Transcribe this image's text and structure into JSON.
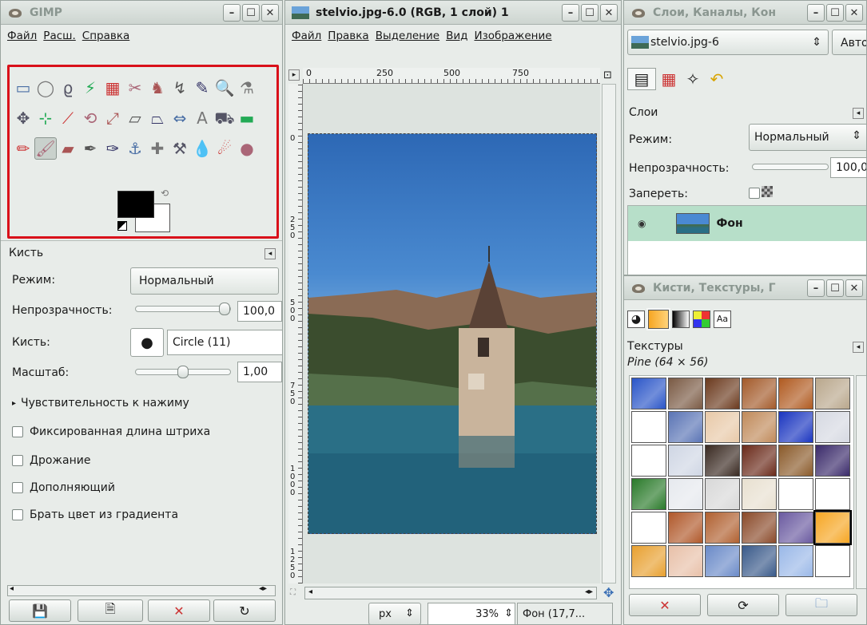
{
  "toolbox": {
    "title": "GIMP",
    "menu": [
      "Файл",
      "Расш.",
      "Справка"
    ],
    "tool_icons": [
      "rect-select-icon",
      "ellipse-select-icon",
      "lasso-icon",
      "fuzzy-select-icon",
      "color-select-icon",
      "scissors-icon",
      "foreground-select-icon",
      "paths-icon",
      "color-picker-icon",
      "zoom-icon",
      "measure-icon",
      "move-icon",
      "align-icon",
      "crop-icon",
      "rotate-icon",
      "scale-icon",
      "shear-icon",
      "perspective-icon",
      "flip-icon",
      "text-icon",
      "bucket-fill-icon",
      "blend-icon",
      "pencil-icon",
      "paintbrush-icon",
      "eraser-icon",
      "airbrush-icon",
      "ink-icon",
      "clone-icon",
      "heal-icon",
      "perspective-clone-icon",
      "blur-icon",
      "smudge-icon",
      "dodge-burn-icon"
    ],
    "tool_glyphs": [
      "▭",
      "◯",
      "ϱ",
      "⚡",
      "▦",
      "✂",
      "♞",
      "↯",
      "✎",
      "🔍",
      "⚗",
      "✥",
      "⊹",
      "⟋",
      "⟲",
      "⤢",
      "▱",
      "⏢",
      "⇔",
      "A",
      "⛟",
      "▬",
      "✏",
      "🖌",
      "▰",
      "✒",
      "✑",
      "⚓",
      "✚",
      "⚒",
      "💧",
      "☄",
      "●"
    ],
    "selected_tool_index": 23
  },
  "tool_options": {
    "header": "Кисть",
    "mode_label": "Режим:",
    "mode_value": "Нормальный",
    "opacity_label": "Непрозрачность:",
    "opacity_value": "100,0",
    "opacity_fraction": 1.0,
    "brush_label": "Кисть:",
    "brush_value": "Circle (11)",
    "scale_label": "Масштаб:",
    "scale_value": "1,00",
    "scale_fraction": 0.5,
    "sensitivity": "Чувствительность к нажиму",
    "checkboxes": [
      "Фиксированная длина штриха",
      "Дрожание",
      "Дополняющий",
      "Брать цвет из градиента"
    ]
  },
  "image_window": {
    "title": "stelvio.jpg-6.0 (RGB, 1 слой) 1",
    "menu": [
      "Файл",
      "Правка",
      "Выделение",
      "Вид",
      "Изображение"
    ],
    "ruler_top": [
      "0",
      "250",
      "500",
      "750"
    ],
    "ruler_left": [
      "0",
      "250",
      "500",
      "750",
      "1000",
      "1250"
    ],
    "unit": "px",
    "zoom": "33%",
    "status": "Фон (17,7..."
  },
  "layers_window": {
    "title": "Слои, Каналы, Кон",
    "image_select": "stelvio.jpg-6",
    "auto_button": "Авто",
    "panel_label": "Слои",
    "mode_label": "Режим:",
    "mode_value": "Нормальный",
    "opacity_label": "Непрозрачность:",
    "opacity_value": "100,0",
    "lock_label": "Запереть:",
    "layer_name": "Фон"
  },
  "brushes_window": {
    "title": "Кисти, Текстуры, Г",
    "panel_label": "Текстуры",
    "pattern_name": "Pine (64 × 56)",
    "tab_text": "Aa"
  },
  "colors": {
    "accent_red": "#d9101a",
    "selected_layer": "#b7dfc9",
    "foreground": "#000000",
    "background": "#ffffff"
  }
}
